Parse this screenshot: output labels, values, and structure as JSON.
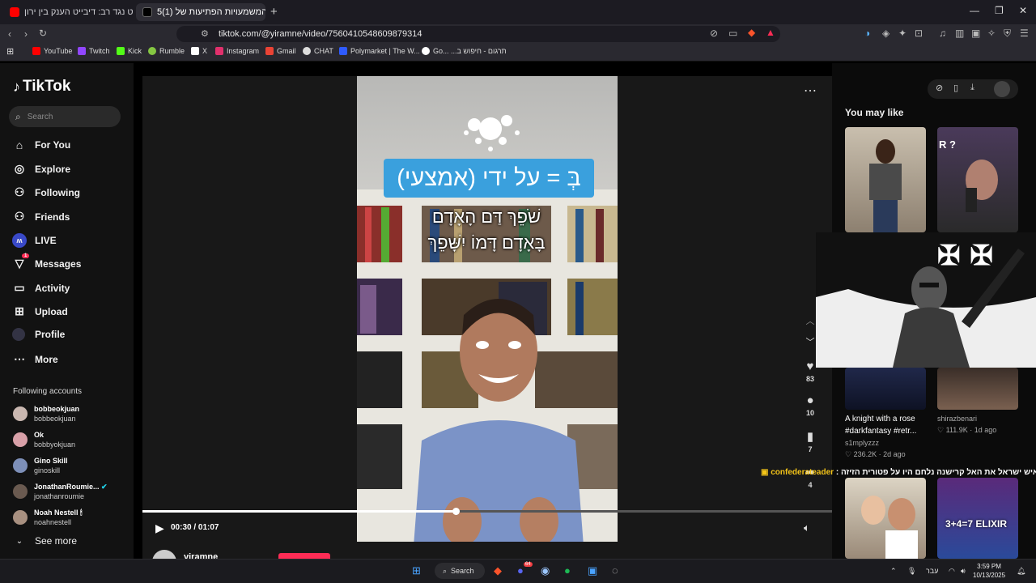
{
  "browser": {
    "tabs": [
      {
        "title": "אתאיסט נגד רב: דיבייט הענק בין ירון",
        "active": false
      },
      {
        "title": "5(1) המשמעויות הפתיעות של",
        "active": true
      }
    ],
    "new_tab_glyph": "+",
    "url": "tiktok.com/@yiramne/video/7560410548609879314",
    "bookmarks": [
      "YouTube",
      "Twitch",
      "Kick",
      "Rumble",
      "X",
      "Instagram",
      "Gmail",
      "CHAT",
      "Polymarket | The W...",
      "Go...",
      "תרגום - חיפוש ב..."
    ],
    "bookmark_colors": [
      "#ff0000",
      "#9146ff",
      "#53fc18",
      "#85c742",
      "#ffffff",
      "#e1306c",
      "#ea4335",
      "#dddddd",
      "#2f5bff",
      "#ffffff",
      "#ffffff"
    ]
  },
  "tiktok": {
    "logo": "TikTok",
    "search_placeholder": "Search",
    "nav": [
      {
        "label": "For You",
        "icon": "home-icon",
        "glyph": "⌂"
      },
      {
        "label": "Explore",
        "icon": "compass-icon",
        "glyph": "◎"
      },
      {
        "label": "Following",
        "icon": "following-icon",
        "glyph": "⚇"
      },
      {
        "label": "Friends",
        "icon": "friends-icon",
        "glyph": "⚇"
      },
      {
        "label": "LIVE",
        "icon": "live-icon",
        "glyph": "●"
      },
      {
        "label": "Messages",
        "icon": "messages-icon",
        "glyph": "✉"
      },
      {
        "label": "Activity",
        "icon": "activity-icon",
        "glyph": "▭"
      },
      {
        "label": "Upload",
        "icon": "upload-icon",
        "glyph": "⊞"
      },
      {
        "label": "Profile",
        "icon": "profile-icon",
        "glyph": "●"
      },
      {
        "label": "More",
        "icon": "more-icon",
        "glyph": "⋯"
      }
    ],
    "messages_badge": "1",
    "following_accounts_title": "Following accounts",
    "following_accounts": [
      {
        "name": "bobbeokjuan",
        "handle": "bobbeokjuan",
        "color": "#c9b7b0"
      },
      {
        "name": "Ok",
        "handle": "bobbyokjuan",
        "color": "#d8a0a8"
      },
      {
        "name": "Gino Skill",
        "handle": "ginoskill",
        "color": "#7d8fb8"
      },
      {
        "name": "JonathanRoumie...",
        "handle": "jonathanroumie",
        "color": "#6a5a50"
      },
      {
        "name": "Noah Nestell 🕯",
        "handle": "noahnestell",
        "color": "#a89080"
      }
    ],
    "see_more": "See more",
    "video": {
      "caption_line1": "בְּ = על ידי (אמצעי)",
      "caption_line2": "שֹׁפֵךְ דַּם הָאָדָם",
      "caption_line3": "בָּאָדָם דָּמוֹ יִשָּׁפֵךְ",
      "time": "00:30 / 01:07",
      "progress": 0.454,
      "author": "yiramne"
    },
    "actions": [
      {
        "name": "like-icon",
        "glyph": "♥",
        "count": "83"
      },
      {
        "name": "comment-icon",
        "glyph": "●",
        "count": "10"
      },
      {
        "name": "bookmark-icon",
        "glyph": "▮",
        "count": "7"
      },
      {
        "name": "share-icon",
        "glyph": "➦",
        "count": "4"
      }
    ],
    "you_may_like": "You may like",
    "recommendations": [
      {
        "caption": "A knight with a rose #darkfantasy #retr...",
        "author": "s1mplyzzz",
        "stats": "♡ 236.2K · 2d ago"
      },
      {
        "caption": "",
        "author": "shirazbenari",
        "stats": "♡ 111.9K · 1d ago"
      }
    ],
    "thumb_text": {
      "tr": "R ?",
      "br": "3+4=7 ELIXIR"
    },
    "chat_overlay": {
      "user": "confederateader",
      "message": ": לף איש ישראל את האל קרישנה נלחם היו על פטורית הזיזה"
    }
  },
  "taskbar": {
    "search": "Search",
    "lang": "עבר",
    "time": "3:59 PM",
    "date": "10/13/2025",
    "discord_badge": "64"
  }
}
